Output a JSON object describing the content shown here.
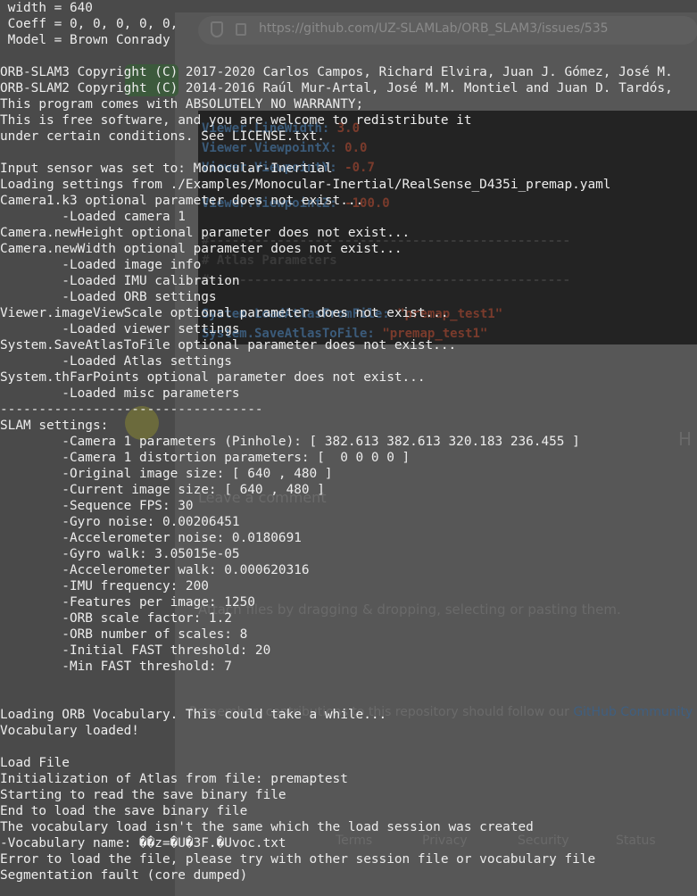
{
  "background_browser": {
    "url": "https://github.com/UZ-SLAMLab/ORB_SLAM3/issues/535",
    "code_lines": [
      {
        "key": "Viewer.LineWidth:",
        "value": "3.0"
      },
      {
        "key": "Viewer.ViewpointX:",
        "value": "0.0"
      },
      {
        "key": "Viewer.ViewpointY:",
        "value": "-0.7"
      },
      {
        "key": "Viewer.ViewpointZ:",
        "value": "-100.0"
      },
      {
        "key": "#------------------------------------------------",
        "value": ""
      },
      {
        "key": "# Atlas Parameters",
        "value": ""
      },
      {
        "key": "#------------------------------------------------",
        "value": ""
      },
      {
        "key": "System.LoadAtlasFromFile:",
        "value": "\"premap_test1\""
      },
      {
        "key": "System.SaveAtlasToFile:",
        "value": "\"premap_test1\""
      }
    ],
    "leave_comment": "Leave a comment",
    "attach_hint": "Attach files by dragging & dropping, selecting or pasting them.",
    "contrib_note": "Remember, contributions to this repository should follow our",
    "contrib_link": "GitHub Community",
    "footer": [
      "Terms",
      "Privacy",
      "Security",
      "Status"
    ],
    "h_letter": "H"
  },
  "terminal": {
    "lines": [
      " width = 640",
      " Coeff = 0, 0, 0, 0, 0,",
      " Model = Brown Conrady",
      "",
      "ORB-SLAM3 Copyright (C) 2017-2020 Carlos Campos, Richard Elvira, Juan J. Gómez, José M.",
      "ORB-SLAM2 Copyright (C) 2014-2016 Raúl Mur-Artal, José M.M. Montiel and Juan D. Tardós,",
      "This program comes with ABSOLUTELY NO WARRANTY;",
      "This is free software, and you are welcome to redistribute it",
      "under certain conditions. See LICENSE.txt.",
      "",
      "Input sensor was set to: Monocular-Inertial",
      "Loading settings from ./Examples/Monocular-Inertial/RealSense_D435i_premap.yaml",
      "Camera1.k3 optional parameter does not exist...",
      "        -Loaded camera 1",
      "Camera.newHeight optional parameter does not exist...",
      "Camera.newWidth optional parameter does not exist...",
      "        -Loaded image info",
      "        -Loaded IMU calibration",
      "        -Loaded ORB settings",
      "Viewer.imageViewScale optional parameter does not exist...",
      "        -Loaded viewer settings",
      "System.SaveAtlasToFile optional parameter does not exist...",
      "        -Loaded Atlas settings",
      "System.thFarPoints optional parameter does not exist...",
      "        -Loaded misc parameters",
      "----------------------------------",
      "SLAM settings: ",
      "        -Camera 1 parameters (Pinhole): [ 382.613 382.613 320.183 236.455 ]",
      "        -Camera 1 distortion parameters: [  0 0 0 0 ]",
      "        -Original image size: [ 640 , 480 ]",
      "        -Current image size: [ 640 , 480 ]",
      "        -Sequence FPS: 30",
      "        -Gyro noise: 0.00206451",
      "        -Accelerometer noise: 0.0180691",
      "        -Gyro walk: 3.05015e-05",
      "        -Accelerometer walk: 0.000620316",
      "        -IMU frequency: 200",
      "        -Features per image: 1250",
      "        -ORB scale factor: 1.2",
      "        -ORB number of scales: 8",
      "        -Initial FAST threshold: 20",
      "        -Min FAST threshold: 7",
      "",
      "",
      "Loading ORB Vocabulary. This could take a while...",
      "Vocabulary loaded!",
      "",
      "Load File",
      "Initialization of Atlas from file: premaptest",
      "Starting to read the save binary file",
      "End to load the save binary file",
      "The vocabulary load isn't the same which the load session was created ",
      "-Vocabulary name: ��z=�U�3F.�Uvoc.txt",
      "Error to load the file, please try with other session file or vocabulary file",
      "Segmentation fault (core dumped)"
    ]
  }
}
